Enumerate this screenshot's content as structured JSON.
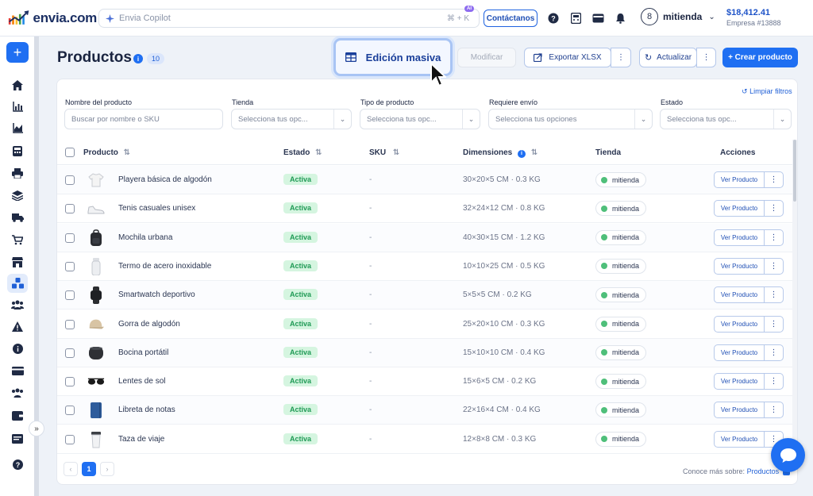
{
  "header": {
    "logo_text": "envia.com",
    "search_placeholder": "Envia Copilot",
    "search_shortcut": "⌘ + K",
    "search_badge": "AI",
    "contact_label": "Contáctanos",
    "user_avatar": "8",
    "user_name": "mitienda",
    "balance": "$18,412.41",
    "company": "Empresa #13888"
  },
  "page": {
    "title": "Productos",
    "count": "10"
  },
  "toolbar": {
    "mass_edit_label": "Edición masiva",
    "modify_label": "Modificar",
    "export_label": "Exportar XLSX",
    "refresh_label": "Actualizar",
    "create_label": "+ Crear producto"
  },
  "filters": {
    "clear_label": "Limpiar filtros",
    "name_label": "Nombre del producto",
    "name_placeholder": "Buscar por nombre o SKU",
    "store_label": "Tienda",
    "store_placeholder": "Selecciona tus opc...",
    "type_label": "Tipo de producto",
    "type_placeholder": "Selecciona tus opc...",
    "shipping_label": "Requiere envío",
    "shipping_placeholder": "Selecciona tus opciones",
    "status_label": "Estado",
    "status_placeholder": "Selecciona tus opc..."
  },
  "table": {
    "columns": {
      "product": "Producto",
      "status": "Estado",
      "sku": "SKU",
      "dimensions": "Dimensiones",
      "store": "Tienda",
      "actions": "Acciones"
    },
    "view_label": "Ver Producto",
    "rows": [
      {
        "name": "Playera básica de algodón",
        "status": "Activa",
        "sku": "-",
        "dims": "30×20×5 CM  ·  0.3 KG",
        "store": "mitienda",
        "icon": "tshirt-icon"
      },
      {
        "name": "Tenis casuales unisex",
        "status": "Activa",
        "sku": "-",
        "dims": "32×24×12 CM  ·  0.8 KG",
        "store": "mitienda",
        "icon": "sneaker-icon"
      },
      {
        "name": "Mochila urbana",
        "status": "Activa",
        "sku": "-",
        "dims": "40×30×15 CM  ·  1.2 KG",
        "store": "mitienda",
        "icon": "backpack-icon"
      },
      {
        "name": "Termo de acero inoxidable",
        "status": "Activa",
        "sku": "-",
        "dims": "10×10×25 CM  ·  0.5 KG",
        "store": "mitienda",
        "icon": "thermos-icon"
      },
      {
        "name": "Smartwatch deportivo",
        "status": "Activa",
        "sku": "-",
        "dims": "5×5×5 CM  ·  0.2 KG",
        "store": "mitienda",
        "icon": "smartwatch-icon"
      },
      {
        "name": "Gorra de algodón",
        "status": "Activa",
        "sku": "-",
        "dims": "25×20×10 CM  ·  0.3 KG",
        "store": "mitienda",
        "icon": "cap-icon"
      },
      {
        "name": "Bocina portátil",
        "status": "Activa",
        "sku": "-",
        "dims": "15×10×10 CM  ·  0.4 KG",
        "store": "mitienda",
        "icon": "speaker-icon"
      },
      {
        "name": "Lentes de sol",
        "status": "Activa",
        "sku": "-",
        "dims": "15×6×5 CM  ·  0.2 KG",
        "store": "mitienda",
        "icon": "sunglasses-icon"
      },
      {
        "name": "Libreta de notas",
        "status": "Activa",
        "sku": "-",
        "dims": "22×16×4 CM  ·  0.4 KG",
        "store": "mitienda",
        "icon": "notebook-icon"
      },
      {
        "name": "Taza de viaje",
        "status": "Activa",
        "sku": "-",
        "dims": "12×8×8 CM  ·  0.3 KG",
        "store": "mitienda",
        "icon": "travel-mug-icon"
      }
    ]
  },
  "pagination": {
    "current": "1"
  },
  "footer": {
    "learn_prefix": "Conoce más sobre:",
    "learn_link": "Productos"
  },
  "colors": {
    "primary": "#1f6ff2",
    "status_green": "#1f9a55",
    "status_bg": "#d5f5e0"
  }
}
